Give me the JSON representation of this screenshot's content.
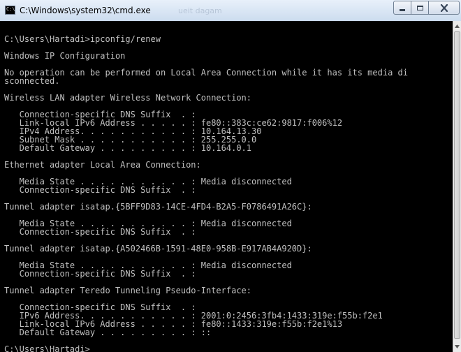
{
  "window": {
    "title": "C:\\Windows\\system32\\cmd.exe",
    "icon": "console-icon",
    "background_hint": "ueit dagam"
  },
  "controls": {
    "minimize_icon": "minimize-icon",
    "maximize_icon": "maximize-icon",
    "close_icon": "close-icon"
  },
  "colors": {
    "console_background": "#000000",
    "console_text": "#C0C0C0",
    "title_bar": "#DBE7F5"
  },
  "console": {
    "lines": [
      "",
      "C:\\Users\\Hartadi>ipconfig/renew",
      "",
      "Windows IP Configuration",
      "",
      "No operation can be performed on Local Area Connection while it has its media di",
      "sconnected.",
      "",
      "Wireless LAN adapter Wireless Network Connection:",
      "",
      "   Connection-specific DNS Suffix  . :",
      "   Link-local IPv6 Address . . . . . : fe80::383c:ce62:9817:f006%12",
      "   IPv4 Address. . . . . . . . . . . : 10.164.13.30",
      "   Subnet Mask . . . . . . . . . . . : 255.255.0.0",
      "   Default Gateway . . . . . . . . . : 10.164.0.1",
      "",
      "Ethernet adapter Local Area Connection:",
      "",
      "   Media State . . . . . . . . . . . : Media disconnected",
      "   Connection-specific DNS Suffix  . :",
      "",
      "Tunnel adapter isatap.{5BFF9D83-14CE-4FD4-B2A5-F0786491A26C}:",
      "",
      "   Media State . . . . . . . . . . . : Media disconnected",
      "   Connection-specific DNS Suffix  . :",
      "",
      "Tunnel adapter isatap.{A502466B-1591-48E0-958B-E917AB4A920D}:",
      "",
      "   Media State . . . . . . . . . . . : Media disconnected",
      "   Connection-specific DNS Suffix  . :",
      "",
      "Tunnel adapter Teredo Tunneling Pseudo-Interface:",
      "",
      "   Connection-specific DNS Suffix  . :",
      "   IPv6 Address. . . . . . . . . . . : 2001:0:2456:3fb4:1433:319e:f55b:f2e1",
      "   Link-local IPv6 Address . . . . . : fe80::1433:319e:f55b:f2e1%13",
      "   Default Gateway . . . . . . . . . : ::",
      "",
      "C:\\Users\\Hartadi>"
    ]
  }
}
